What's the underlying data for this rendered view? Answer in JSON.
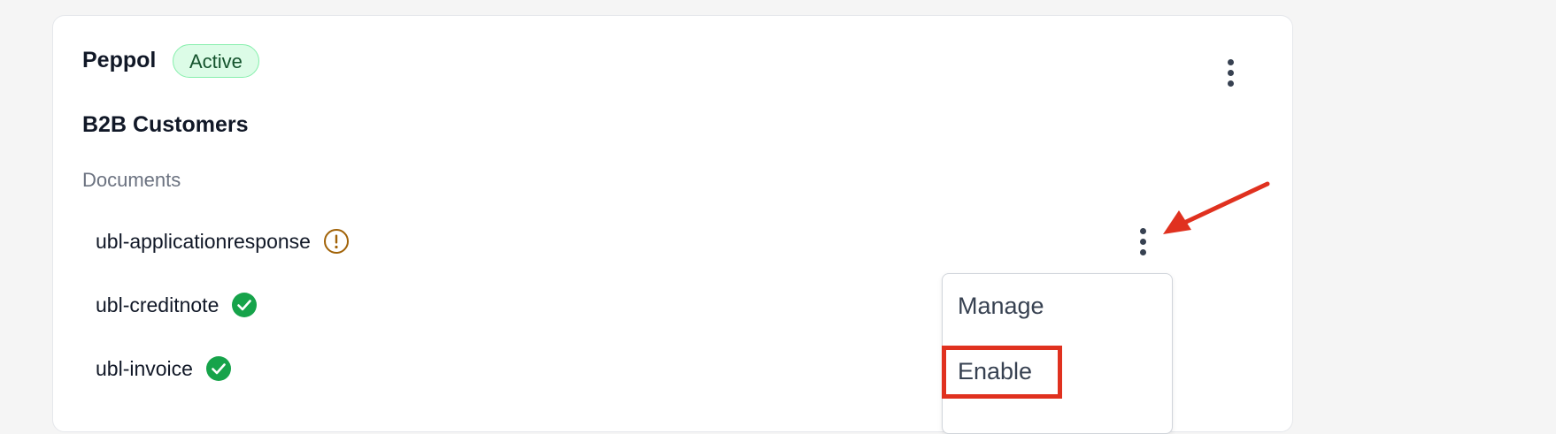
{
  "provider": {
    "name": "Peppol",
    "status": "Active",
    "status_color": "#dcfce7"
  },
  "section": {
    "title": "B2B Customers",
    "subheading": "Documents"
  },
  "documents": [
    {
      "label": "ubl-applicationresponse",
      "status_icon": "warning-icon"
    },
    {
      "label": "ubl-creditnote",
      "status_icon": "check-circle-icon"
    },
    {
      "label": "ubl-invoice",
      "status_icon": "check-circle-icon"
    }
  ],
  "context_menu": {
    "items": [
      "Manage",
      "Enable"
    ],
    "highlighted_item": "Enable"
  },
  "annotation": {
    "arrow_color": "#e0311f",
    "highlight_color": "#e0311f"
  },
  "icons": {
    "more": "vertical-dots-icon",
    "warning": "warning-icon",
    "success": "check-circle-icon"
  }
}
